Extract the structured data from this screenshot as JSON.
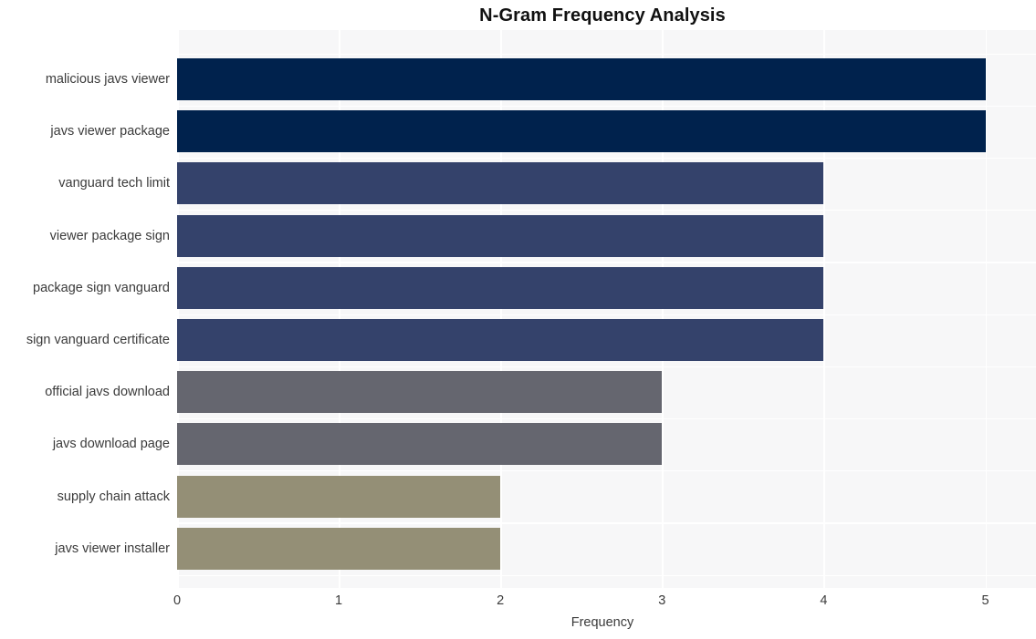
{
  "chart_data": {
    "type": "bar",
    "orientation": "horizontal",
    "title": "N-Gram Frequency Analysis",
    "xlabel": "Frequency",
    "ylabel": "",
    "xlim": [
      0,
      5.3
    ],
    "xticks": [
      "0",
      "1",
      "2",
      "3",
      "4",
      "5"
    ],
    "xtick_values": [
      0,
      1,
      2,
      3,
      4,
      5
    ],
    "grid": true,
    "grid_color": "#ffffff",
    "plot_background": "#f7f7f8",
    "legend": null,
    "categories": [
      "malicious javs viewer",
      "javs viewer package",
      "vanguard tech limit",
      "viewer package sign",
      "package sign vanguard",
      "sign vanguard certificate",
      "official javs download",
      "javs download page",
      "supply chain attack",
      "javs viewer installer"
    ],
    "values": [
      5,
      5,
      4,
      4,
      4,
      4,
      3,
      3,
      2,
      2
    ],
    "bar_colors": [
      "#00224d",
      "#00224d",
      "#34426b",
      "#34426b",
      "#34426b",
      "#34426b",
      "#65666f",
      "#65666f",
      "#948f76",
      "#948f76"
    ],
    "palette": {
      "rank_5": "#00224d",
      "rank_4": "#34426b",
      "rank_3": "#65666f",
      "rank_2": "#948f76"
    },
    "text_color": "#3b3b3b",
    "title_color": "#111111"
  }
}
